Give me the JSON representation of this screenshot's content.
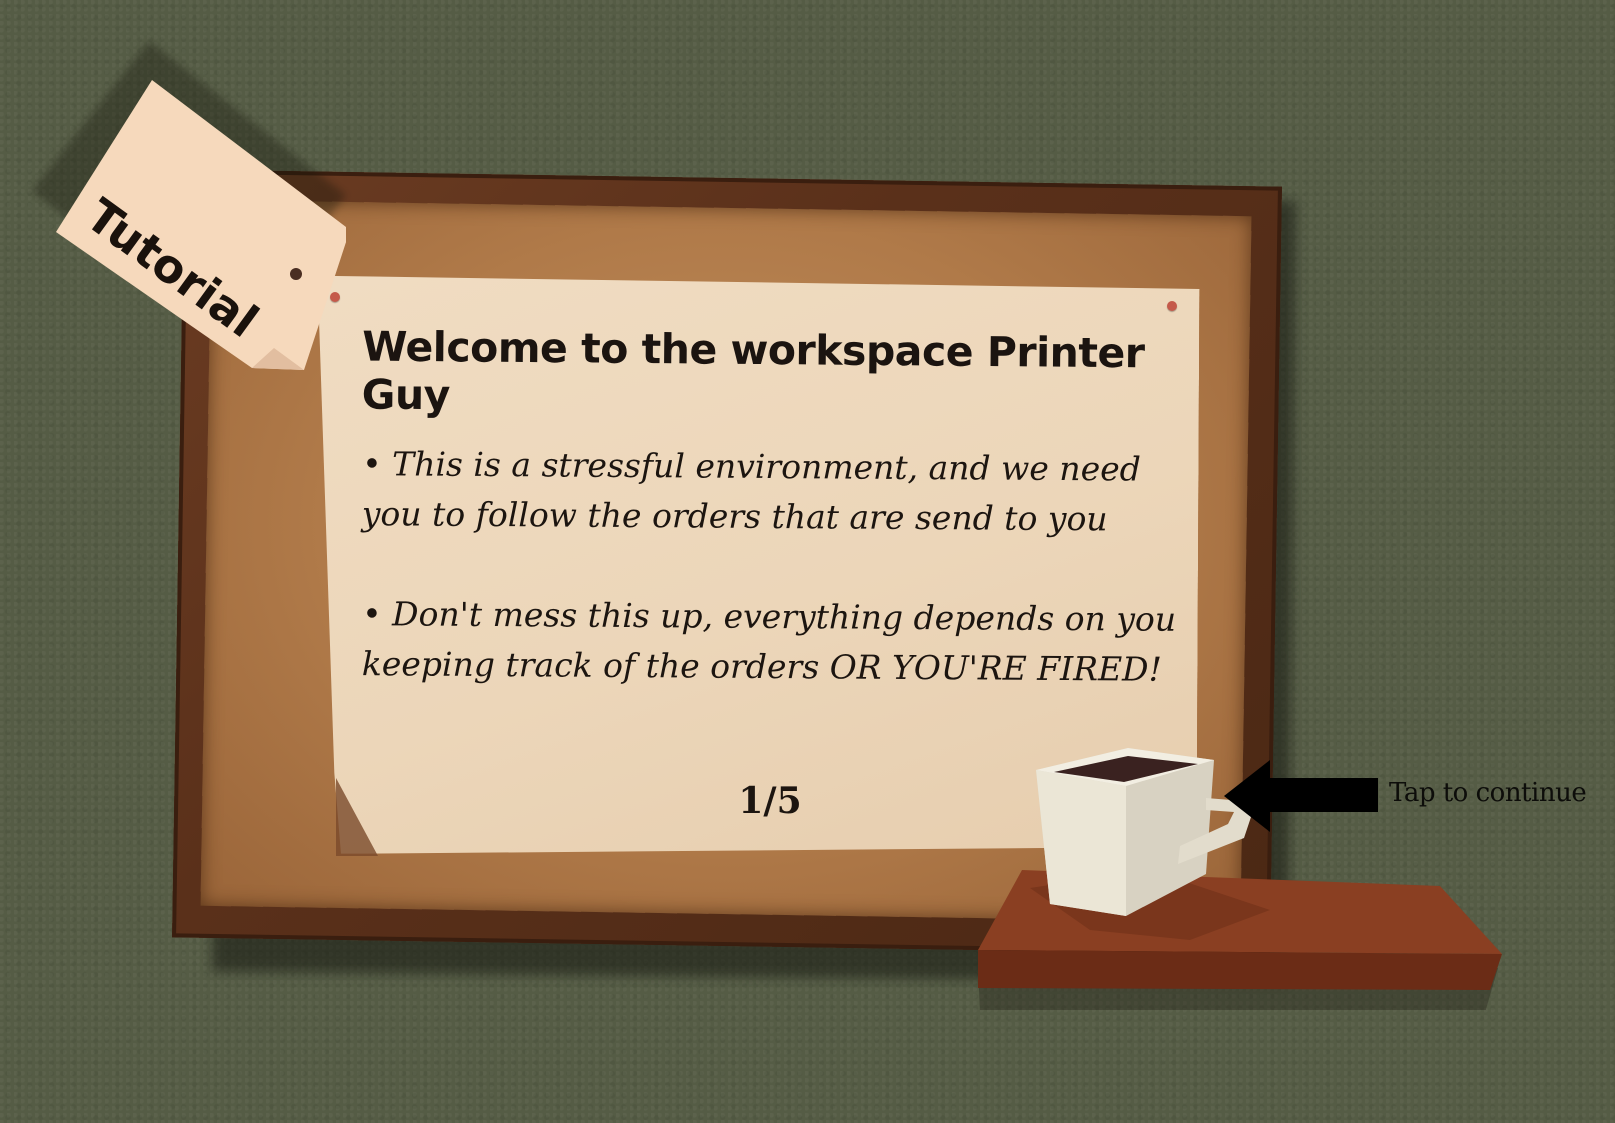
{
  "tutorial_tag": {
    "label": "Tutorial"
  },
  "notice": {
    "title": "Welcome to the workspace Printer Guy",
    "bullets": [
      "• This is a stressful environment, and we need you to follow the orders that are send to you",
      "• Don't mess this up, everything depends on you keeping track of the orders OR YOU'RE FIRED!"
    ],
    "page_indicator": "1/5"
  },
  "continue_prompt": {
    "label": "Tap to continue",
    "icon": "arrow-left-icon"
  },
  "decor": {
    "icons": [
      "coffee-mug-icon",
      "shelf-icon",
      "pin-icon"
    ]
  },
  "colors": {
    "wall": "#555c45",
    "frame": "#5a301a",
    "cork": "#b07a49",
    "paper": "#ecd6b9",
    "pin": "#c55a4a",
    "text": "#1b1410"
  }
}
